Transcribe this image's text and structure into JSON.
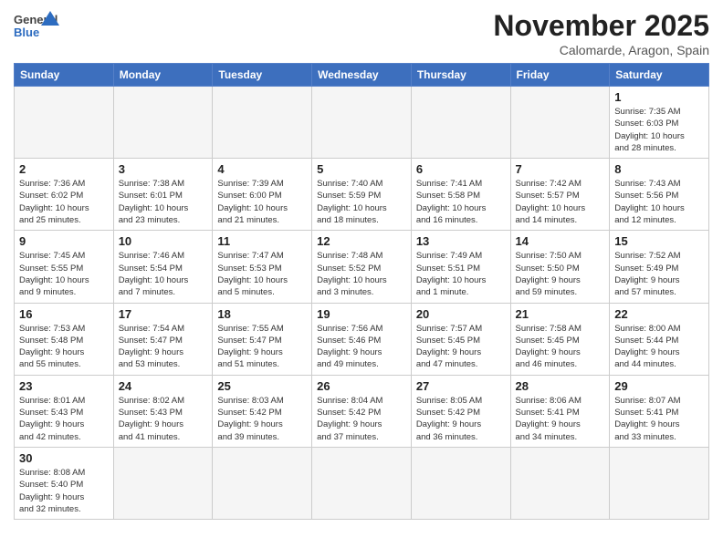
{
  "header": {
    "logo_text_general": "General",
    "logo_text_blue": "Blue",
    "month_title": "November 2025",
    "subtitle": "Calomarde, Aragon, Spain"
  },
  "weekdays": [
    "Sunday",
    "Monday",
    "Tuesday",
    "Wednesday",
    "Thursday",
    "Friday",
    "Saturday"
  ],
  "weeks": [
    [
      {
        "day": "",
        "info": ""
      },
      {
        "day": "",
        "info": ""
      },
      {
        "day": "",
        "info": ""
      },
      {
        "day": "",
        "info": ""
      },
      {
        "day": "",
        "info": ""
      },
      {
        "day": "",
        "info": ""
      },
      {
        "day": "1",
        "info": "Sunrise: 7:35 AM\nSunset: 6:03 PM\nDaylight: 10 hours\nand 28 minutes."
      }
    ],
    [
      {
        "day": "2",
        "info": "Sunrise: 7:36 AM\nSunset: 6:02 PM\nDaylight: 10 hours\nand 25 minutes."
      },
      {
        "day": "3",
        "info": "Sunrise: 7:38 AM\nSunset: 6:01 PM\nDaylight: 10 hours\nand 23 minutes."
      },
      {
        "day": "4",
        "info": "Sunrise: 7:39 AM\nSunset: 6:00 PM\nDaylight: 10 hours\nand 21 minutes."
      },
      {
        "day": "5",
        "info": "Sunrise: 7:40 AM\nSunset: 5:59 PM\nDaylight: 10 hours\nand 18 minutes."
      },
      {
        "day": "6",
        "info": "Sunrise: 7:41 AM\nSunset: 5:58 PM\nDaylight: 10 hours\nand 16 minutes."
      },
      {
        "day": "7",
        "info": "Sunrise: 7:42 AM\nSunset: 5:57 PM\nDaylight: 10 hours\nand 14 minutes."
      },
      {
        "day": "8",
        "info": "Sunrise: 7:43 AM\nSunset: 5:56 PM\nDaylight: 10 hours\nand 12 minutes."
      }
    ],
    [
      {
        "day": "9",
        "info": "Sunrise: 7:45 AM\nSunset: 5:55 PM\nDaylight: 10 hours\nand 9 minutes."
      },
      {
        "day": "10",
        "info": "Sunrise: 7:46 AM\nSunset: 5:54 PM\nDaylight: 10 hours\nand 7 minutes."
      },
      {
        "day": "11",
        "info": "Sunrise: 7:47 AM\nSunset: 5:53 PM\nDaylight: 10 hours\nand 5 minutes."
      },
      {
        "day": "12",
        "info": "Sunrise: 7:48 AM\nSunset: 5:52 PM\nDaylight: 10 hours\nand 3 minutes."
      },
      {
        "day": "13",
        "info": "Sunrise: 7:49 AM\nSunset: 5:51 PM\nDaylight: 10 hours\nand 1 minute."
      },
      {
        "day": "14",
        "info": "Sunrise: 7:50 AM\nSunset: 5:50 PM\nDaylight: 9 hours\nand 59 minutes."
      },
      {
        "day": "15",
        "info": "Sunrise: 7:52 AM\nSunset: 5:49 PM\nDaylight: 9 hours\nand 57 minutes."
      }
    ],
    [
      {
        "day": "16",
        "info": "Sunrise: 7:53 AM\nSunset: 5:48 PM\nDaylight: 9 hours\nand 55 minutes."
      },
      {
        "day": "17",
        "info": "Sunrise: 7:54 AM\nSunset: 5:47 PM\nDaylight: 9 hours\nand 53 minutes."
      },
      {
        "day": "18",
        "info": "Sunrise: 7:55 AM\nSunset: 5:47 PM\nDaylight: 9 hours\nand 51 minutes."
      },
      {
        "day": "19",
        "info": "Sunrise: 7:56 AM\nSunset: 5:46 PM\nDaylight: 9 hours\nand 49 minutes."
      },
      {
        "day": "20",
        "info": "Sunrise: 7:57 AM\nSunset: 5:45 PM\nDaylight: 9 hours\nand 47 minutes."
      },
      {
        "day": "21",
        "info": "Sunrise: 7:58 AM\nSunset: 5:45 PM\nDaylight: 9 hours\nand 46 minutes."
      },
      {
        "day": "22",
        "info": "Sunrise: 8:00 AM\nSunset: 5:44 PM\nDaylight: 9 hours\nand 44 minutes."
      }
    ],
    [
      {
        "day": "23",
        "info": "Sunrise: 8:01 AM\nSunset: 5:43 PM\nDaylight: 9 hours\nand 42 minutes."
      },
      {
        "day": "24",
        "info": "Sunrise: 8:02 AM\nSunset: 5:43 PM\nDaylight: 9 hours\nand 41 minutes."
      },
      {
        "day": "25",
        "info": "Sunrise: 8:03 AM\nSunset: 5:42 PM\nDaylight: 9 hours\nand 39 minutes."
      },
      {
        "day": "26",
        "info": "Sunrise: 8:04 AM\nSunset: 5:42 PM\nDaylight: 9 hours\nand 37 minutes."
      },
      {
        "day": "27",
        "info": "Sunrise: 8:05 AM\nSunset: 5:42 PM\nDaylight: 9 hours\nand 36 minutes."
      },
      {
        "day": "28",
        "info": "Sunrise: 8:06 AM\nSunset: 5:41 PM\nDaylight: 9 hours\nand 34 minutes."
      },
      {
        "day": "29",
        "info": "Sunrise: 8:07 AM\nSunset: 5:41 PM\nDaylight: 9 hours\nand 33 minutes."
      }
    ],
    [
      {
        "day": "30",
        "info": "Sunrise: 8:08 AM\nSunset: 5:40 PM\nDaylight: 9 hours\nand 32 minutes."
      },
      {
        "day": "",
        "info": ""
      },
      {
        "day": "",
        "info": ""
      },
      {
        "day": "",
        "info": ""
      },
      {
        "day": "",
        "info": ""
      },
      {
        "day": "",
        "info": ""
      },
      {
        "day": "",
        "info": ""
      }
    ]
  ]
}
